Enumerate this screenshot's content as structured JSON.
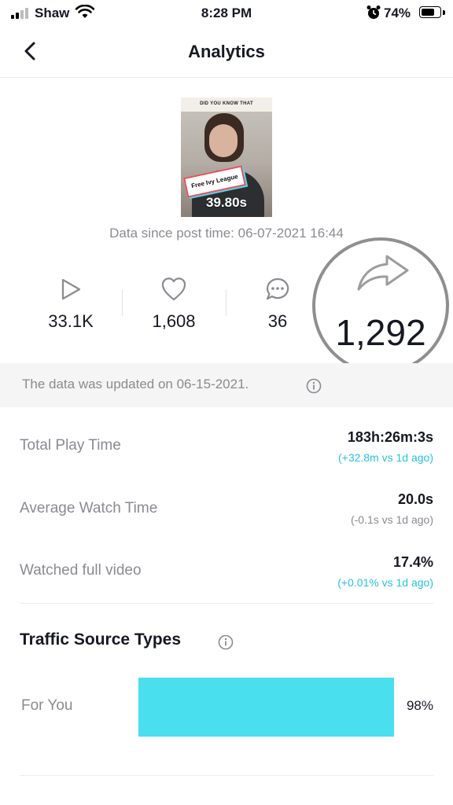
{
  "status_bar": {
    "carrier": "Shaw",
    "time": "8:28 PM",
    "battery_percent": "74%",
    "battery_level": 0.74
  },
  "nav": {
    "title": "Analytics"
  },
  "video": {
    "thumbnail_caption": "DID YOU KNOW THAT",
    "thumbnail_banner": "Free Ivy League",
    "duration": "39.80s",
    "data_since": "Data since post time: 06-07-2021 16:44"
  },
  "metrics": {
    "views": "33.1K",
    "likes": "1,608",
    "comments": "36",
    "shares": "1,292"
  },
  "update_notice": "The data was updated on 06-15-2021.",
  "stats": [
    {
      "label": "Total Play Time",
      "value": "183h:26m:3s",
      "change": "(+32.8m vs 1d ago)",
      "change_color": "#28c2de"
    },
    {
      "label": "Average Watch Time",
      "value": "20.0s",
      "change": "(-0.1s vs 1d ago)",
      "change_color": "#8a8b91"
    },
    {
      "label": "Watched full video",
      "value": "17.4%",
      "change": "(+0.01% vs 1d ago)",
      "change_color": "#28c2de"
    }
  ],
  "traffic": {
    "title": "Traffic Source Types",
    "sources": [
      {
        "label": "For You",
        "percent": "98%",
        "fraction": 0.98
      }
    ]
  },
  "colors": {
    "accent_teal": "#28c2de",
    "bar_fill": "#4adfee",
    "muted_text": "#8a8b91",
    "annotation_circle": "#8f8f8f"
  },
  "icons": {
    "back": "chevron-left-icon",
    "views": "play-icon",
    "likes": "heart-icon",
    "comments": "comment-icon",
    "shares": "share-arrow-icon",
    "info": "info-icon"
  }
}
